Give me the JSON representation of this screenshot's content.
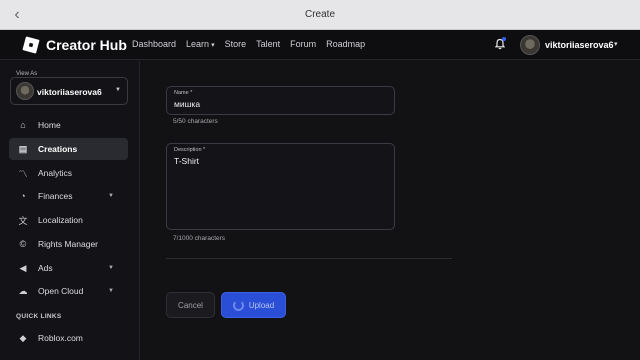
{
  "window": {
    "title": "Create"
  },
  "nav": {
    "brand": "Creator Hub",
    "links": [
      "Dashboard",
      "Learn",
      "Store",
      "Talent",
      "Forum",
      "Roadmap"
    ],
    "user": "viktoriiaserova6"
  },
  "sidebar": {
    "view_as_label": "View As",
    "view_as_user": "viktoriiaserova6",
    "items": [
      {
        "label": "Home",
        "icon": "home-icon"
      },
      {
        "label": "Creations",
        "icon": "creations-icon"
      },
      {
        "label": "Analytics",
        "icon": "analytics-icon"
      },
      {
        "label": "Finances",
        "icon": "finances-icon"
      },
      {
        "label": "Localization",
        "icon": "localization-icon"
      },
      {
        "label": "Rights Manager",
        "icon": "rights-icon"
      },
      {
        "label": "Ads",
        "icon": "ads-icon"
      },
      {
        "label": "Open Cloud",
        "icon": "cloud-icon"
      }
    ],
    "quick_links_label": "QUICK LINKS",
    "quick_links": [
      {
        "label": "Roblox.com",
        "icon": "roblox-icon"
      }
    ]
  },
  "form": {
    "name_label": "Name *",
    "name_value": "мишка",
    "name_counter": "5/50 characters",
    "description_label": "Description *",
    "description_value": "T-Shirt",
    "description_counter": "7/1000 characters",
    "cancel_label": "Cancel",
    "upload_label": "Upload"
  }
}
